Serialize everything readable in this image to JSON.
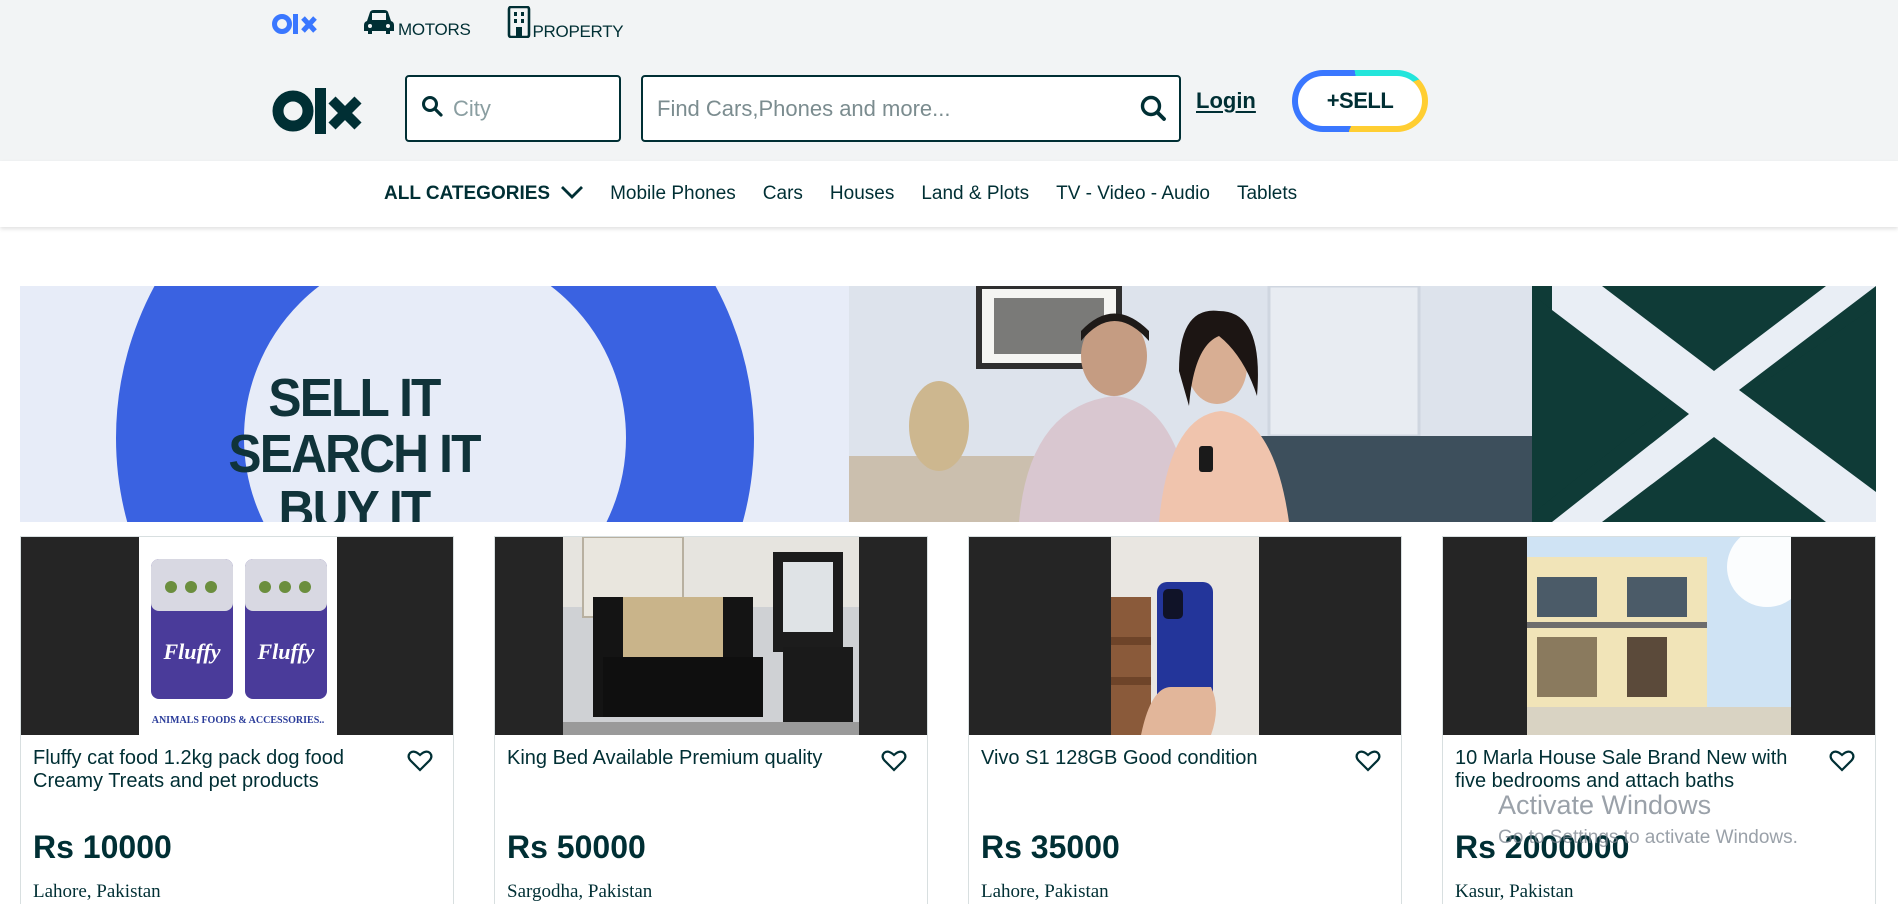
{
  "header": {
    "top_links": [
      {
        "label": "MOTORS",
        "icon": "car-icon"
      },
      {
        "label": "PROPERTY",
        "icon": "building-icon"
      }
    ],
    "city_placeholder": "City",
    "search_placeholder": "Find Cars,Phones and more...",
    "login_label": "Login",
    "sell_label": "+SELL"
  },
  "categories": {
    "all_label": "ALL CATEGORIES",
    "items": [
      "Mobile Phones",
      "Cars",
      "Houses",
      "Land & Plots",
      "TV - Video - Audio",
      "Tablets"
    ]
  },
  "banner": {
    "lines": [
      "SELL IT",
      "SEARCH IT",
      "BUY IT"
    ]
  },
  "listings": [
    {
      "title": "Fluffy cat food 1.2kg pack dog food Creamy Treats and pet products",
      "price": "Rs 10000",
      "location": "Lahore, Pakistan",
      "photo_caption": "ANIMALS FOODS & ACCESSORIES..",
      "photo_brand": "Fluffy"
    },
    {
      "title": "King Bed Available Premium quality",
      "price": "Rs 50000",
      "location": "Sargodha, Pakistan"
    },
    {
      "title": "Vivo S1 128GB Good condition",
      "price": "Rs 35000",
      "location": "Lahore, Pakistan"
    },
    {
      "title": "10 Marla House Sale Brand New with five bedrooms and attach baths",
      "price": "Rs 2000000",
      "location": "Kasur, Pakistan"
    }
  ],
  "watermark": {
    "line1": "Activate Windows",
    "line2": "Go to Settings to activate Windows."
  },
  "colors": {
    "brand_dark": "#002f34",
    "brand_blue": "#3a77ff",
    "brand_teal": "#23e5db",
    "brand_yellow": "#ffce32",
    "header_bg": "#f2f4f5"
  }
}
